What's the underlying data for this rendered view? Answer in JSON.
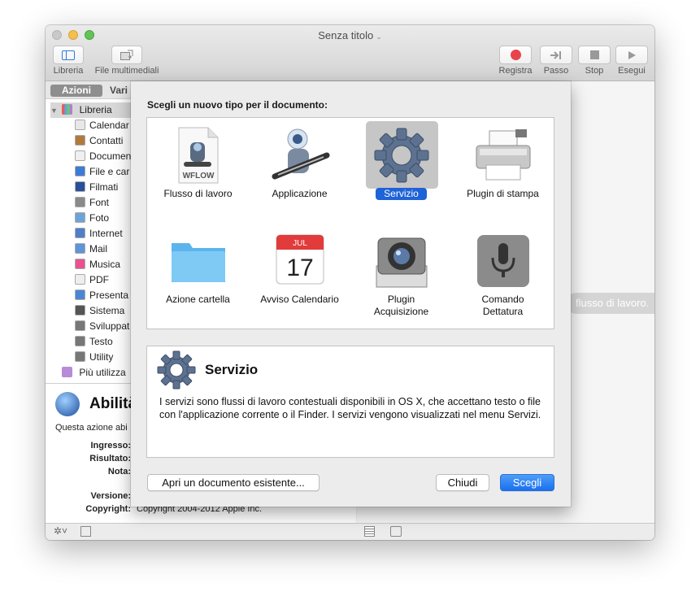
{
  "window": {
    "title": "Senza titolo",
    "title_chevron": "⌄"
  },
  "toolbar": {
    "left": [
      {
        "label": "Libreria",
        "icon": "sidebar-icon"
      },
      {
        "label": "File multimediali",
        "icon": "media-icon"
      }
    ],
    "right": [
      {
        "label": "Registra",
        "icon": "record-icon"
      },
      {
        "label": "Passo",
        "icon": "step-icon"
      },
      {
        "label": "Stop",
        "icon": "stop-icon"
      },
      {
        "label": "Esegui",
        "icon": "play-icon"
      }
    ]
  },
  "sidebar": {
    "tabs": [
      "Azioni",
      "Vari"
    ],
    "root": "Libreria",
    "items": [
      {
        "label": "Calendar",
        "color": "#e8e8e8"
      },
      {
        "label": "Contatti",
        "color": "#b07a3d"
      },
      {
        "label": "Documen",
        "color": "#f0f0f0"
      },
      {
        "label": "File e car",
        "color": "#3d7cd6"
      },
      {
        "label": "Filmati",
        "color": "#2a4f9b"
      },
      {
        "label": "Font",
        "color": "#8a8a8a"
      },
      {
        "label": "Foto",
        "color": "#6ea3d9"
      },
      {
        "label": "Internet",
        "color": "#4f7fc9"
      },
      {
        "label": "Mail",
        "color": "#5e94d8"
      },
      {
        "label": "Musica",
        "color": "#e8538f"
      },
      {
        "label": "PDF",
        "color": "#eeeeee"
      },
      {
        "label": "Presenta",
        "color": "#4a86d4"
      },
      {
        "label": "Sistema",
        "color": "#555555"
      },
      {
        "label": "Sviluppat",
        "color": "#777777"
      },
      {
        "label": "Testo",
        "color": "#777777"
      },
      {
        "label": "Utility",
        "color": "#777777"
      }
    ],
    "recent": "Più utilizza"
  },
  "detail": {
    "title": "Abilità",
    "subtitle": "Questa azione abi",
    "fields": [
      {
        "label": "Ingresso:",
        "value": ""
      },
      {
        "label": "Risultato:",
        "value": ""
      },
      {
        "label": "Nota:",
        "value": ""
      },
      {
        "label": "Versione:",
        "value": ""
      },
      {
        "label": "Copyright:",
        "value": "Copyright 2004-2012 Apple Inc."
      }
    ]
  },
  "workflow_hint": "flusso di lavoro.",
  "sheet": {
    "prompt": "Scegli un nuovo tipo per il documento:",
    "types": [
      {
        "label": "Flusso di lavoro",
        "icon": "workflow-file-icon",
        "badge": "WFLOW"
      },
      {
        "label": "Applicazione",
        "icon": "automator-robot-icon"
      },
      {
        "label": "Servizio",
        "icon": "gear-icon",
        "selected": true
      },
      {
        "label": "Plugin di stampa",
        "icon": "printer-icon"
      },
      {
        "label": "Azione cartella",
        "icon": "folder-icon"
      },
      {
        "label": "Avviso Calendario",
        "icon": "calendar-icon",
        "month": "JUL",
        "day": "17"
      },
      {
        "label": "Plugin Acquisizione",
        "icon": "camera-icon"
      },
      {
        "label": "Comando Dettatura",
        "icon": "microphone-icon"
      }
    ],
    "description": {
      "title": "Servizio",
      "text": "I servizi sono flussi di lavoro contestuali disponibili in OS X, che accettano testo o file con l'applicazione corrente o il Finder. I servizi vengono visualizzati nel menu Servizi."
    },
    "buttons": {
      "open": "Apri un documento esistente...",
      "close": "Chiudi",
      "choose": "Scegli"
    }
  }
}
